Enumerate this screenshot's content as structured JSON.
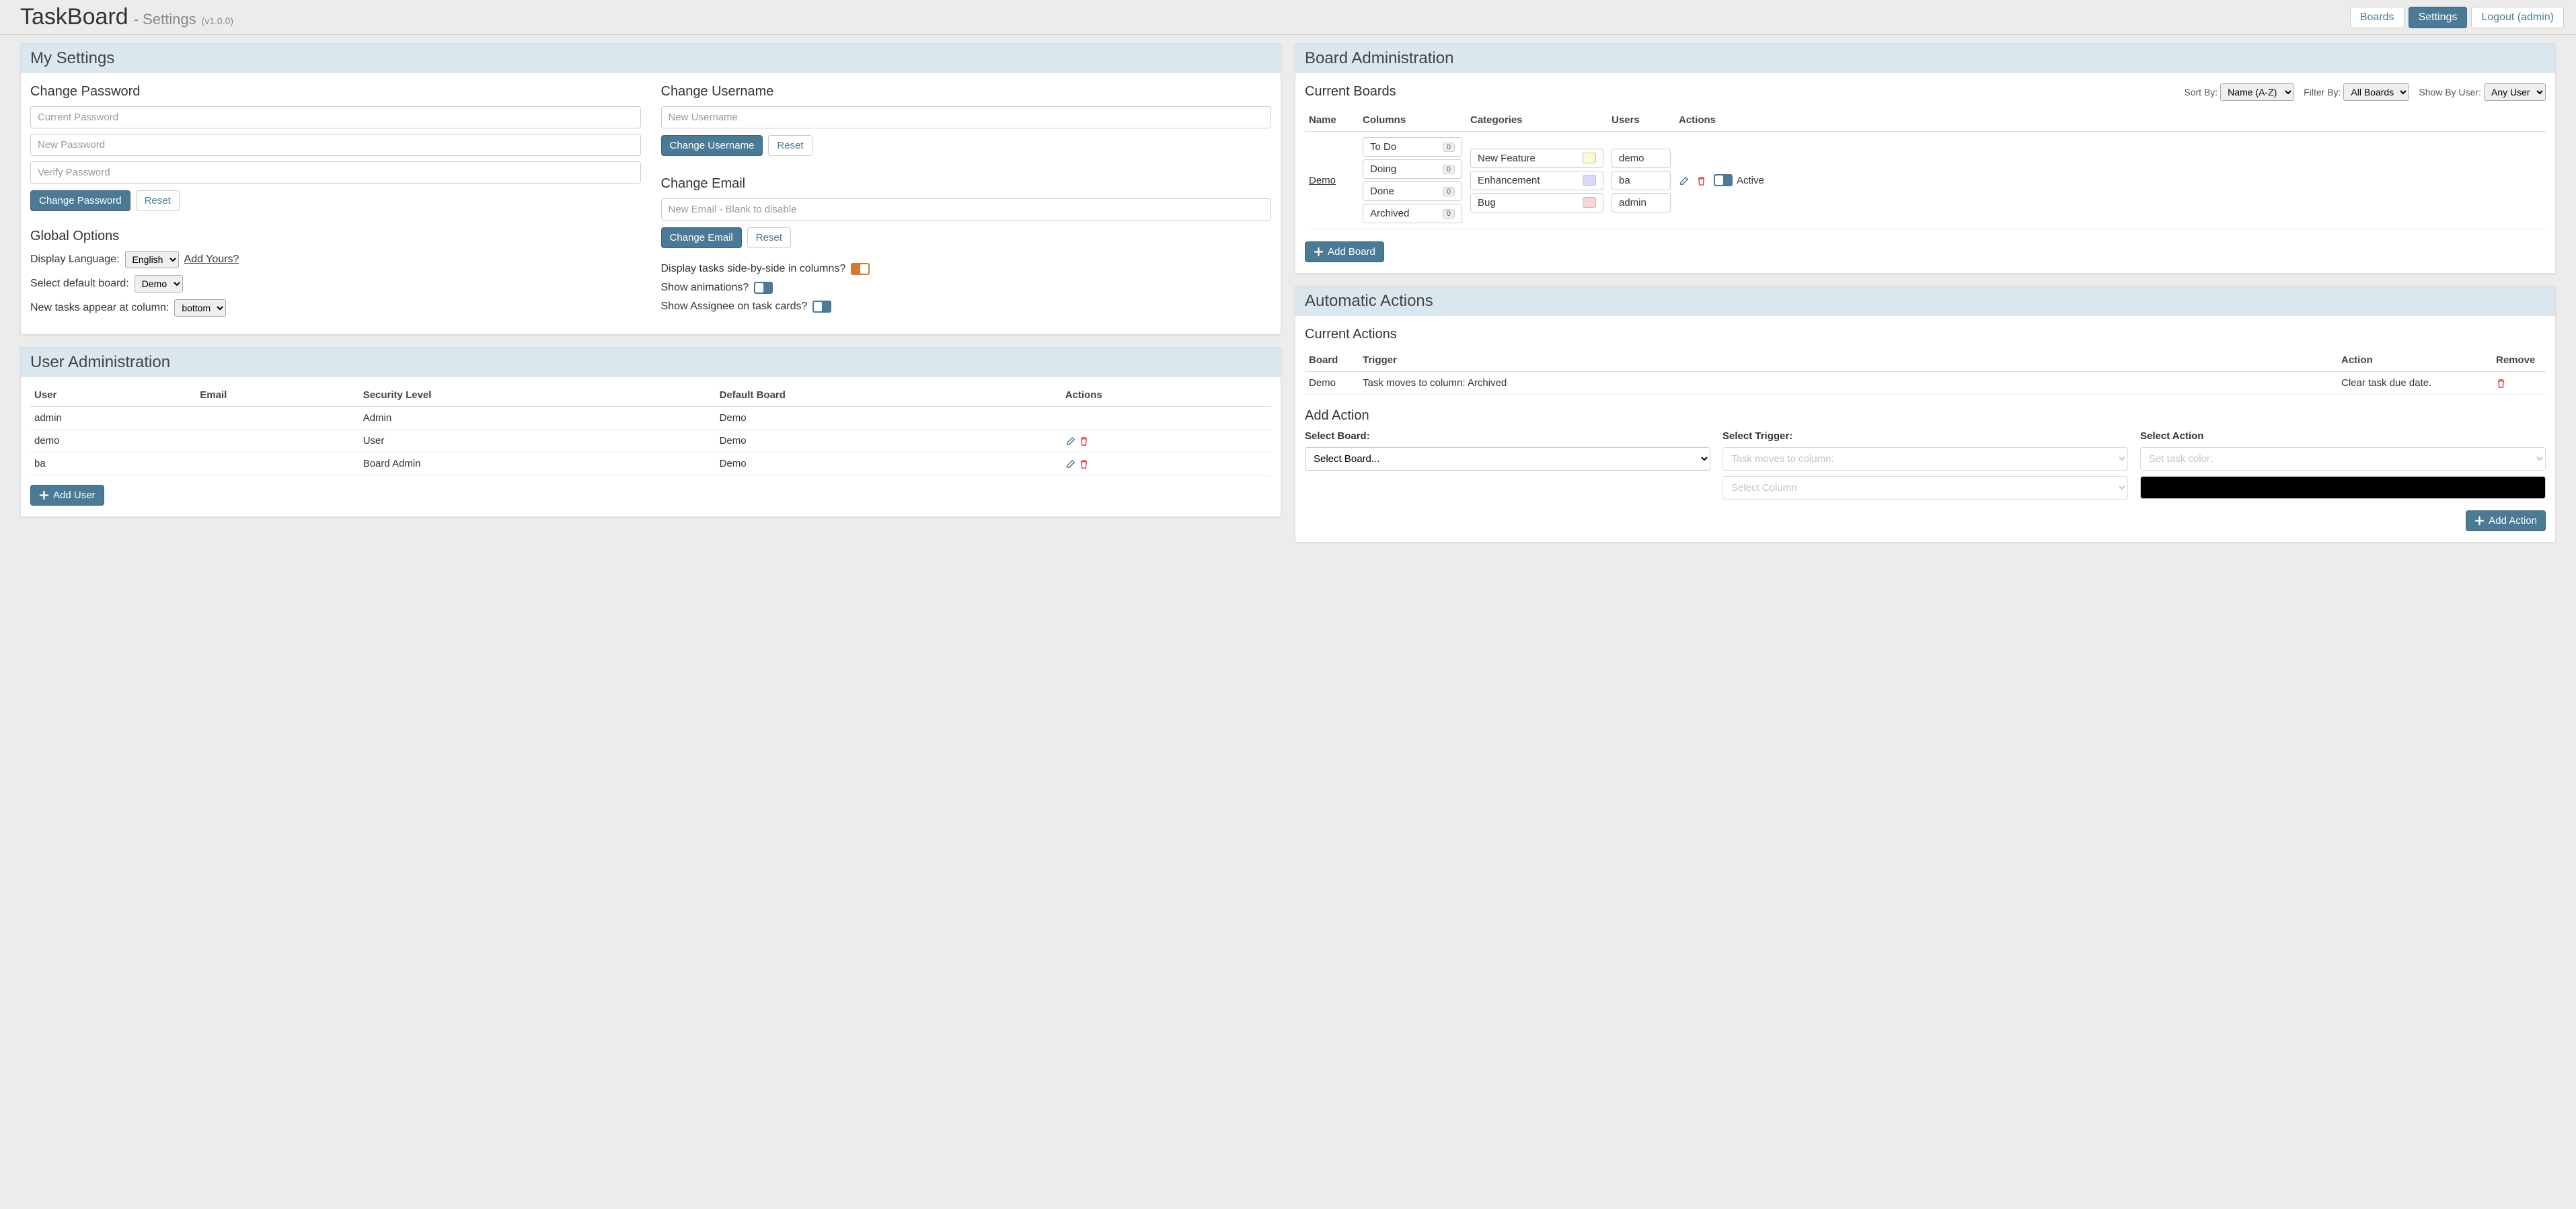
{
  "header": {
    "app_title": "TaskBoard",
    "page_subtitle": "- Settings",
    "version": "(v1.0.0)",
    "nav": {
      "boards": "Boards",
      "settings": "Settings",
      "logout": "Logout (admin)"
    }
  },
  "my_settings": {
    "title": "My Settings",
    "change_password": {
      "title": "Change Password",
      "current_ph": "Current Password",
      "new_ph": "New Password",
      "verify_ph": "Verify Password",
      "submit": "Change Password",
      "reset": "Reset"
    },
    "change_username": {
      "title": "Change Username",
      "new_ph": "New Username",
      "submit": "Change Username",
      "reset": "Reset"
    },
    "change_email": {
      "title": "Change Email",
      "new_ph": "New Email - Blank to disable",
      "submit": "Change Email",
      "reset": "Reset"
    },
    "global_options": {
      "title": "Global Options",
      "display_language_label": "Display Language:",
      "display_language_value": "English",
      "add_yours": "Add Yours?",
      "default_board_label": "Select default board:",
      "default_board_value": "Demo",
      "new_tasks_label": "New tasks appear at column:",
      "new_tasks_value": "bottom",
      "side_by_side_label": "Display tasks side-by-side in columns?",
      "show_animations_label": "Show animations?",
      "show_assignee_label": "Show Assignee on task cards?"
    }
  },
  "user_admin": {
    "title": "User Administration",
    "headers": {
      "user": "User",
      "email": "Email",
      "level": "Security Level",
      "default_board": "Default Board",
      "actions": "Actions"
    },
    "rows": [
      {
        "user": "admin",
        "email": "",
        "level": "Admin",
        "board": "Demo",
        "editable": false
      },
      {
        "user": "demo",
        "email": "",
        "level": "User",
        "board": "Demo",
        "editable": true
      },
      {
        "user": "ba",
        "email": "",
        "level": "Board Admin",
        "board": "Demo",
        "editable": true
      }
    ],
    "add_user": "Add User"
  },
  "board_admin": {
    "title": "Board Administration",
    "current_boards": "Current Boards",
    "sort_by_label": "Sort By:",
    "sort_by_value": "Name (A-Z)",
    "filter_by_label": "Filter By:",
    "filter_by_value": "All Boards",
    "show_by_user_label": "Show By User:",
    "show_by_user_value": "Any User",
    "headers": {
      "name": "Name",
      "columns": "Columns",
      "categories": "Categories",
      "users": "Users",
      "actions": "Actions"
    },
    "board": {
      "name": "Demo",
      "columns": [
        {
          "name": "To Do",
          "count": "0"
        },
        {
          "name": "Doing",
          "count": "0"
        },
        {
          "name": "Done",
          "count": "0"
        },
        {
          "name": "Archived",
          "count": "0"
        }
      ],
      "categories": [
        {
          "name": "New Feature"
        },
        {
          "name": "Enhancement"
        },
        {
          "name": "Bug"
        }
      ],
      "users": [
        "demo",
        "ba",
        "admin"
      ],
      "active_label": "Active"
    },
    "add_board": "Add Board"
  },
  "auto_actions": {
    "title": "Automatic Actions",
    "current_actions": "Current Actions",
    "headers": {
      "board": "Board",
      "trigger": "Trigger",
      "action": "Action",
      "remove": "Remove"
    },
    "rows": [
      {
        "board": "Demo",
        "trigger": "Task moves to column: Archived",
        "action": "Clear task due date."
      }
    ],
    "add_action": {
      "title": "Add Action",
      "select_board_label": "Select Board:",
      "select_board_ph": "Select Board...",
      "select_trigger_label": "Select Trigger:",
      "select_trigger_ph": "Task moves to column:",
      "select_column_ph": "Select Column",
      "select_action_label": "Select Action",
      "select_action_ph": "Set task color:",
      "add_button": "Add Action"
    }
  }
}
